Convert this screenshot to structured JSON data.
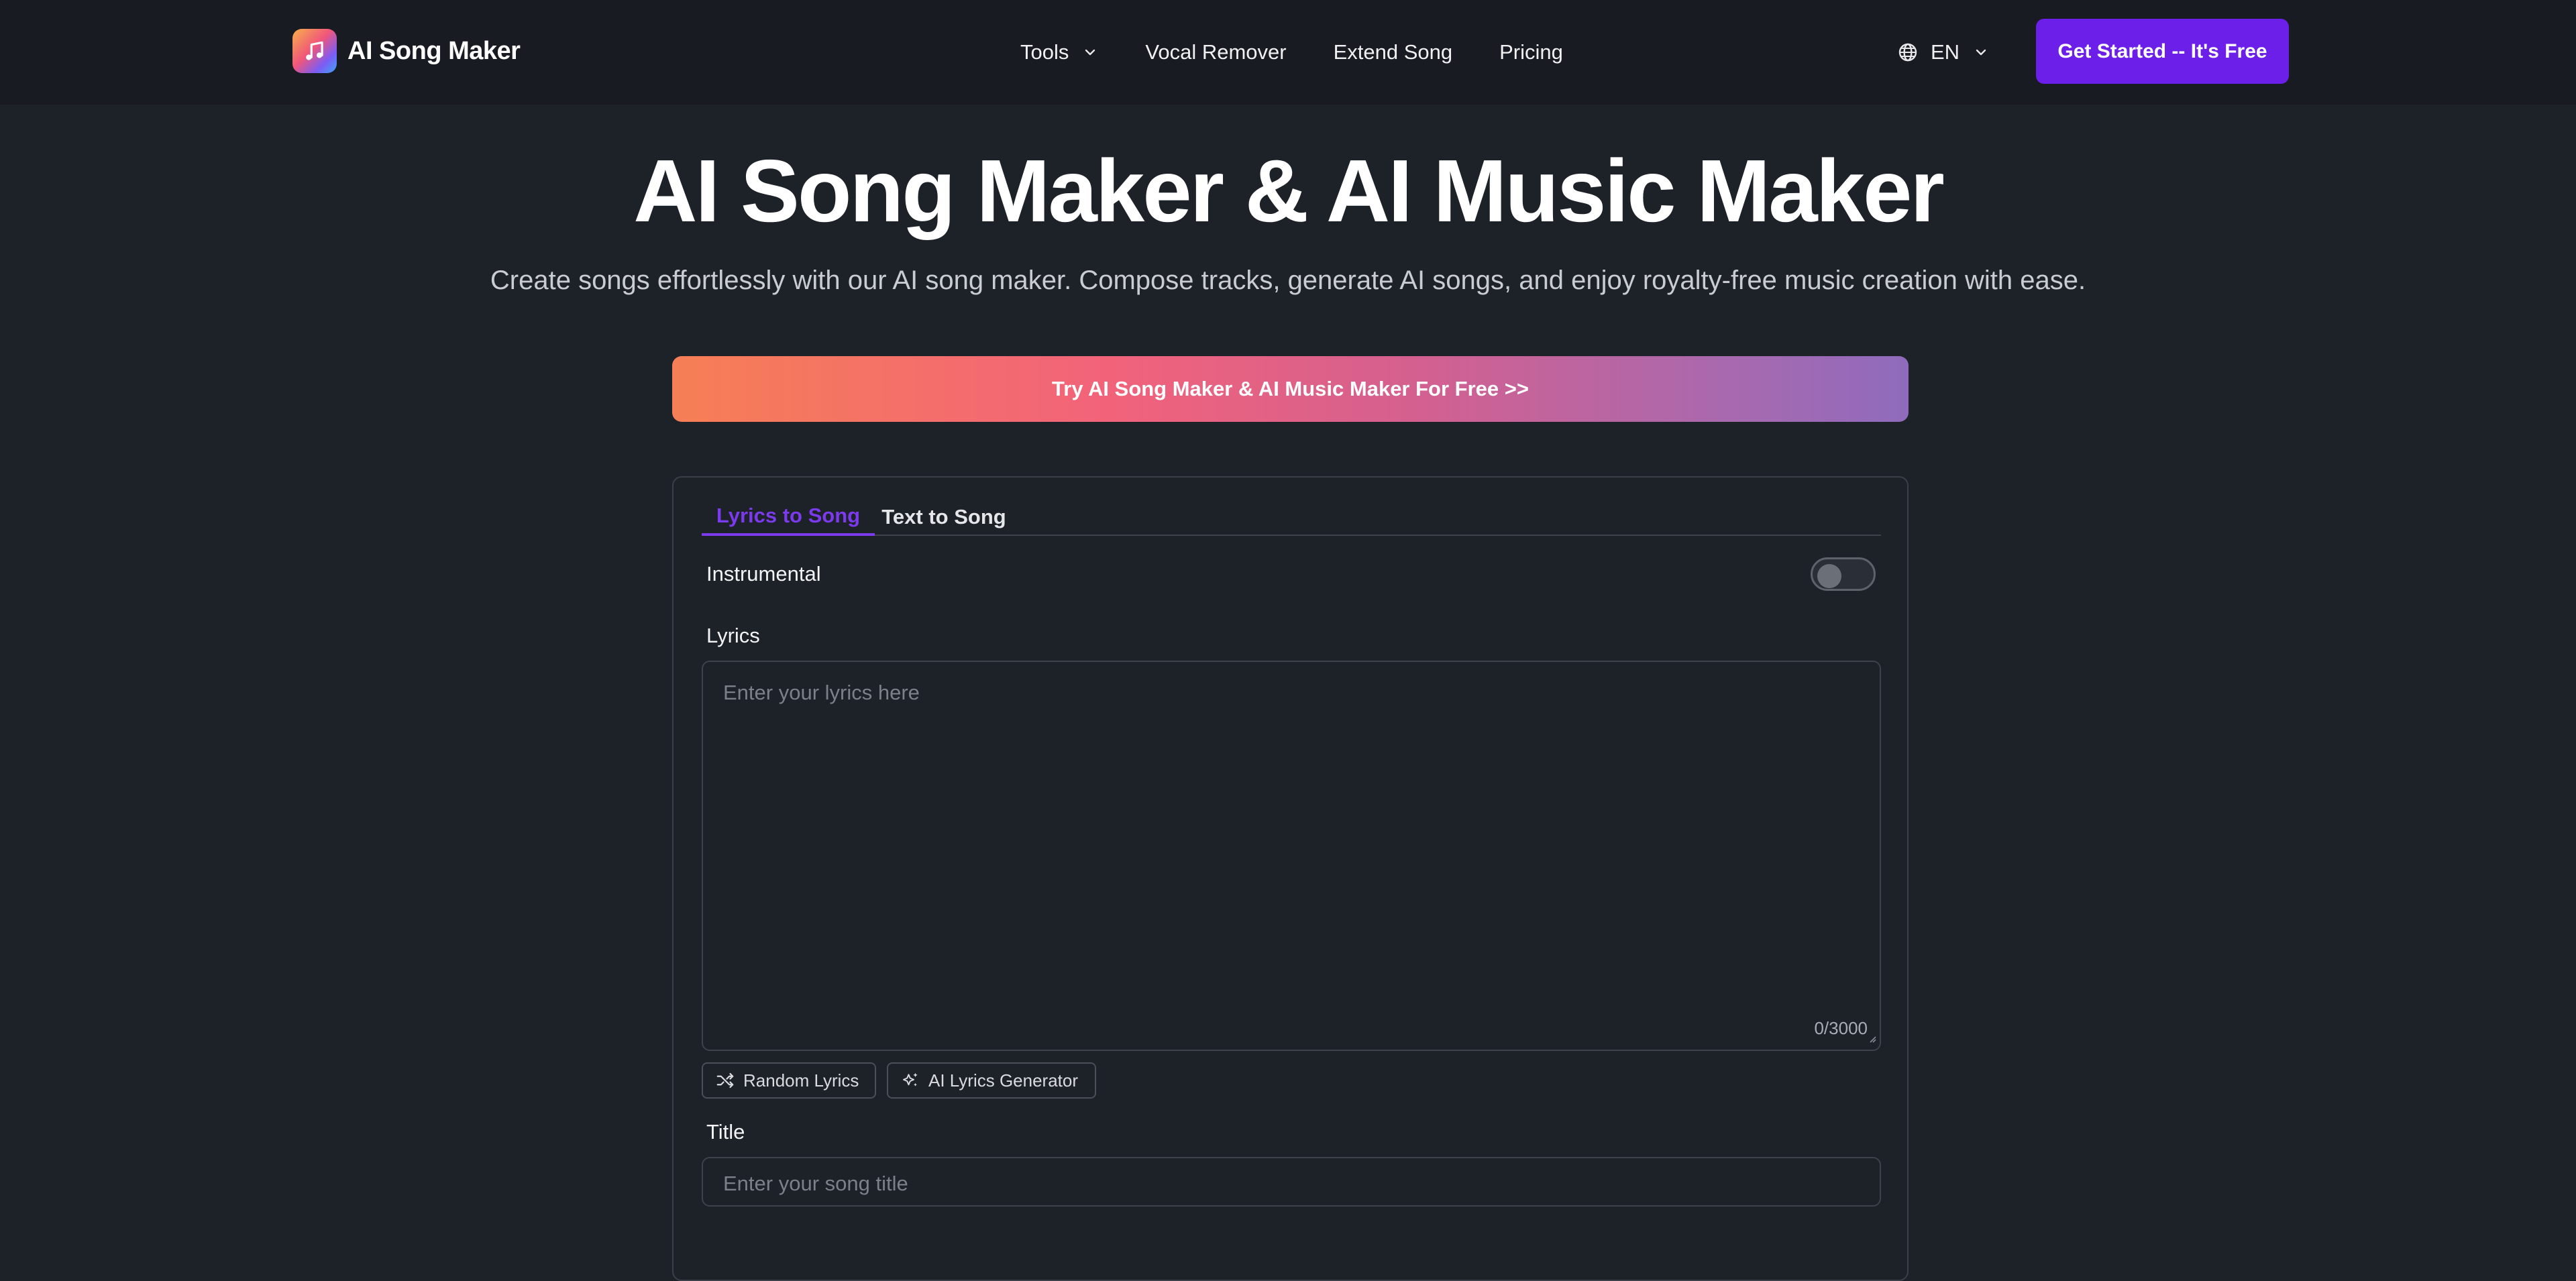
{
  "header": {
    "logo_text": "AI Song Maker",
    "nav": [
      {
        "label": "Tools",
        "has_dropdown": true
      },
      {
        "label": "Vocal Remover"
      },
      {
        "label": "Extend Song"
      },
      {
        "label": "Pricing"
      }
    ],
    "language": "EN",
    "cta_label": "Get Started -- It's Free"
  },
  "hero": {
    "title": "AI Song Maker & AI Music Maker",
    "subtitle": "Create songs effortlessly with our AI song maker. Compose tracks, generate AI songs, and enjoy royalty-free music creation with ease.",
    "try_button": "Try AI Song Maker & AI Music Maker For Free >>"
  },
  "form": {
    "tabs": [
      {
        "label": "Lyrics to Song",
        "active": true
      },
      {
        "label": "Text to Song",
        "active": false
      }
    ],
    "instrumental_label": "Instrumental",
    "instrumental_on": false,
    "lyrics_label": "Lyrics",
    "lyrics_placeholder": "Enter your lyrics here",
    "lyrics_counter": "0/3000",
    "random_lyrics_label": "Random Lyrics",
    "ai_lyrics_label": "AI Lyrics Generator",
    "title_label": "Title",
    "title_placeholder": "Enter your song title"
  },
  "colors": {
    "accent": "#6b1fe8",
    "tab_active": "#7c3aed",
    "background": "#1d2128",
    "header_bg": "#181b21"
  },
  "icons": [
    "music-note-icon",
    "chevron-down-icon",
    "globe-icon",
    "shuffle-icon",
    "sparkles-icon",
    "resize-handle-icon"
  ]
}
